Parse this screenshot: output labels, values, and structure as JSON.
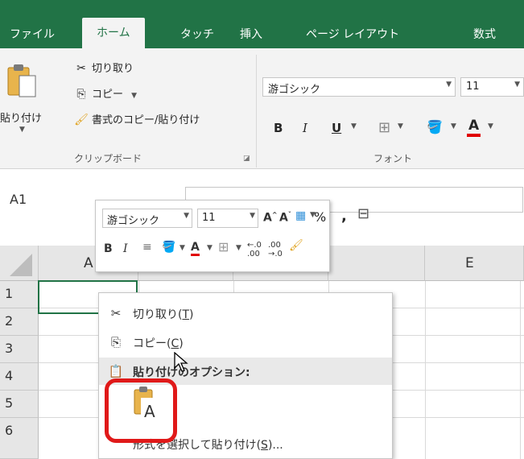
{
  "ribbon_tabs": [
    {
      "label": "ファイル"
    },
    {
      "label": "ホーム",
      "active": true
    },
    {
      "label": "タッチ"
    },
    {
      "label": "挿入"
    },
    {
      "label": "ページ レイアウト"
    },
    {
      "label": "数式"
    }
  ],
  "clipboard": {
    "paste_label": "貼り付け",
    "cut_label": "切り取り",
    "copy_label": "コピー",
    "format_painter_label": "書式のコピー/貼り付け",
    "group_label": "クリップボード"
  },
  "font_group": {
    "font_name": "游ゴシック",
    "font_size": "11",
    "group_label": "フォント",
    "bold": "B",
    "italic": "I",
    "underline": "U"
  },
  "name_box": {
    "value": "A1"
  },
  "mini_toolbar": {
    "font_name": "游ゴシック",
    "font_size": "11",
    "bold": "B",
    "italic": "I",
    "percent": "%",
    "comma": ","
  },
  "grid": {
    "columns": [
      "A",
      "E"
    ],
    "rows": [
      "1",
      "2",
      "3",
      "4",
      "5",
      "6"
    ]
  },
  "context_menu": {
    "cut": {
      "label": "切り取り(",
      "key": "T",
      "tail": ")"
    },
    "copy": {
      "label": "コピー(",
      "key": "C",
      "tail": ")"
    },
    "paste_options_header": "貼り付けのオプション:",
    "paste_special": {
      "label": "形式を選択して貼り付け(",
      "key": "S",
      "tail": ")..."
    }
  },
  "colors": {
    "accent_green": "#217346",
    "highlight_red": "#e01919",
    "font_color_red": "#e00000"
  }
}
